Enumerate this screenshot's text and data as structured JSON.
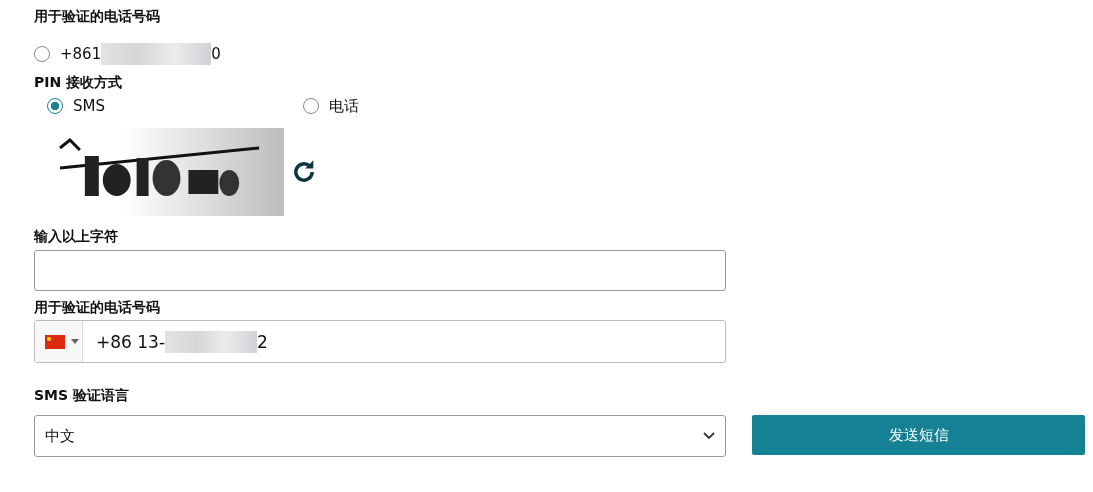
{
  "phone_section": {
    "label": "用于验证的电话号码",
    "option": {
      "prefix": "+861",
      "suffix": "0",
      "selected": false
    }
  },
  "pin_method": {
    "label": "PIN 接收方式",
    "options": [
      {
        "label": "SMS",
        "selected": true
      },
      {
        "label": "电话",
        "selected": false
      }
    ]
  },
  "captcha_input": {
    "label": "输入以上字符"
  },
  "phone_input": {
    "label": "用于验证的电话号码",
    "prefix": "+86 13-",
    "suffix": "2"
  },
  "language": {
    "label": "SMS 验证语言",
    "value": "中文"
  },
  "send_button": "发送短信"
}
